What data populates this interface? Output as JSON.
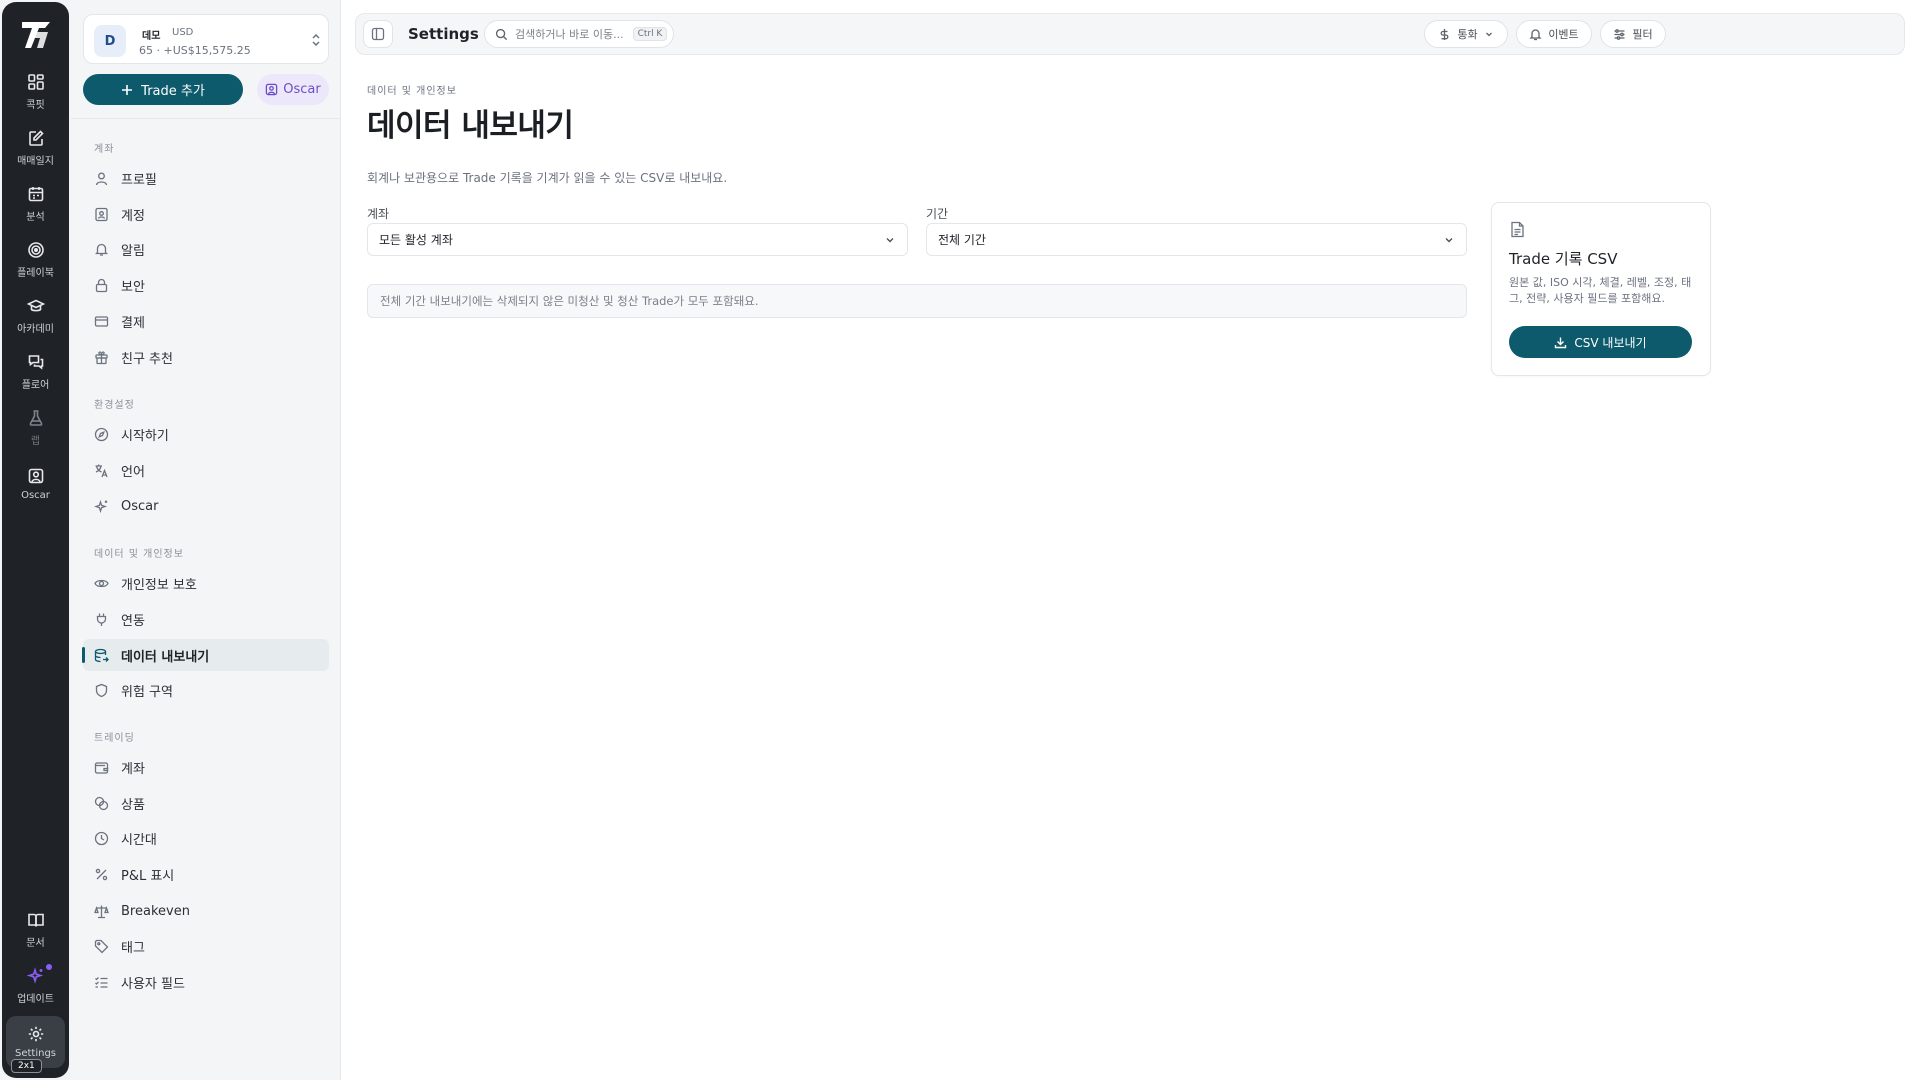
{
  "rail": {
    "items": [
      {
        "label": "콕핏",
        "icon": "grid-icon"
      },
      {
        "label": "매매일지",
        "icon": "journal-edit-icon"
      },
      {
        "label": "분석",
        "icon": "calendar-icon"
      },
      {
        "label": "플레이북",
        "icon": "target-icon"
      },
      {
        "label": "아카데미",
        "icon": "graduation-cap-icon"
      },
      {
        "label": "플로어",
        "icon": "chat-icon"
      },
      {
        "label": "랩",
        "icon": "flask-icon"
      },
      {
        "label": "Oscar",
        "icon": "user-square-icon"
      }
    ],
    "bottom": [
      {
        "label": "문서",
        "icon": "book-icon"
      },
      {
        "label": "업데이트",
        "icon": "sparkle-icon"
      },
      {
        "label": "Settings",
        "icon": "gear-icon"
      }
    ],
    "badge": "2x1"
  },
  "account": {
    "avatar": "D",
    "name": "데모",
    "currency": "USD",
    "summary": "65 · +US$15,575.25"
  },
  "actions": {
    "add_trade": "Trade 추가",
    "oscar": "Oscar"
  },
  "sidebar": {
    "sections": [
      {
        "title": "계좌",
        "items": [
          {
            "label": "프로필",
            "icon": "user-icon"
          },
          {
            "label": "계정",
            "icon": "id-card-icon"
          },
          {
            "label": "알림",
            "icon": "bell-icon"
          },
          {
            "label": "보안",
            "icon": "lock-icon"
          },
          {
            "label": "결제",
            "icon": "credit-card-icon"
          },
          {
            "label": "친구 추천",
            "icon": "gift-icon"
          }
        ]
      },
      {
        "title": "환경설정",
        "items": [
          {
            "label": "시작하기",
            "icon": "compass-icon"
          },
          {
            "label": "언어",
            "icon": "translate-icon"
          },
          {
            "label": "Oscar",
            "icon": "sparkle-icon"
          }
        ]
      },
      {
        "title": "데이터 및 개인정보",
        "items": [
          {
            "label": "개인정보 보호",
            "icon": "eye-icon"
          },
          {
            "label": "연동",
            "icon": "plug-icon"
          },
          {
            "label": "데이터 내보내기",
            "icon": "database-export-icon"
          },
          {
            "label": "위험 구역",
            "icon": "shield-icon"
          }
        ]
      },
      {
        "title": "트레이딩",
        "items": [
          {
            "label": "계좌",
            "icon": "wallet-icon"
          },
          {
            "label": "상품",
            "icon": "coins-icon"
          },
          {
            "label": "시간대",
            "icon": "clock-icon"
          },
          {
            "label": "P&L 표시",
            "icon": "percent-icon"
          },
          {
            "label": "Breakeven",
            "icon": "scale-icon"
          },
          {
            "label": "태그",
            "icon": "tag-icon"
          },
          {
            "label": "사용자 필드",
            "icon": "list-checks-icon"
          }
        ]
      }
    ],
    "active": "데이터 내보내기"
  },
  "topbar": {
    "title": "Settings",
    "search_placeholder": "검색하거나 바로 이동...",
    "shortcut": "Ctrl K",
    "currency": "통화",
    "events": "이벤트",
    "filter": "필터"
  },
  "page": {
    "breadcrumb": "데이터 및 개인정보",
    "title": "데이터 내보내기",
    "description": "회계나 보관용으로 Trade 기록을 기계가 읽을 수 있는 CSV로 내보내요.",
    "account_label": "계좌",
    "account_value": "모든 활성 계좌",
    "period_label": "기간",
    "period_value": "전체 기간",
    "note": "전체 기간 내보내기에는 삭제되지 않은 미청산 및 청산 Trade가 모두 포함돼요."
  },
  "export_card": {
    "title": "Trade 기록 CSV",
    "description": "원본 값, ISO 시각, 체결, 레벨, 조정, 태그, 전략, 사용자 필드를 포함해요.",
    "button": "CSV 내보내기"
  },
  "colors": {
    "primary": "#0c5a6b",
    "rail_bg": "#1f2328",
    "oscar_purple": "#6d4fc4"
  }
}
